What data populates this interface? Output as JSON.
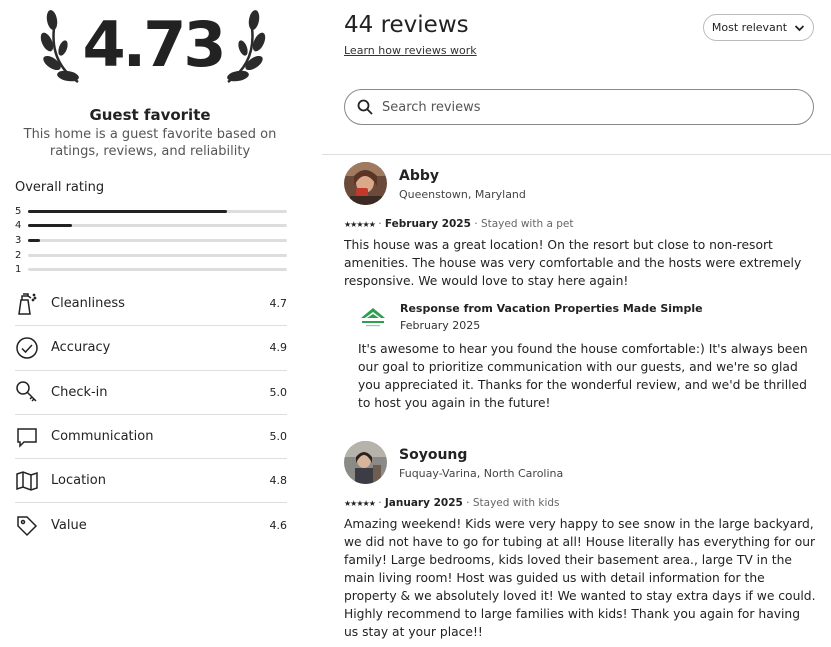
{
  "summary": {
    "overall_score": "4.73",
    "badge_title": "Guest favorite",
    "badge_description": "This home is a guest favorite based on ratings, reviews, and reliability"
  },
  "overall_rating": {
    "title": "Overall rating",
    "distribution": [
      {
        "stars": "5",
        "fraction": 0.77
      },
      {
        "stars": "4",
        "fraction": 0.17
      },
      {
        "stars": "3",
        "fraction": 0.045
      },
      {
        "stars": "2",
        "fraction": 0
      },
      {
        "stars": "1",
        "fraction": 0
      }
    ]
  },
  "categories": [
    {
      "label": "Cleanliness",
      "score": "4.7",
      "icon": "spray-bottle-icon"
    },
    {
      "label": "Accuracy",
      "score": "4.9",
      "icon": "check-circle-icon"
    },
    {
      "label": "Check-in",
      "score": "5.0",
      "icon": "key-icon"
    },
    {
      "label": "Communication",
      "score": "5.0",
      "icon": "chat-bubble-icon"
    },
    {
      "label": "Location",
      "score": "4.8",
      "icon": "map-icon"
    },
    {
      "label": "Value",
      "score": "4.6",
      "icon": "tag-icon"
    }
  ],
  "reviews_header": {
    "count_label": "44 reviews",
    "learn_link": "Learn how reviews work",
    "sort_label": "Most relevant",
    "search_placeholder": "Search reviews"
  },
  "reviews": [
    {
      "name": "Abby",
      "location": "Queenstown, Maryland",
      "stars": "★★★★★",
      "date": "February 2025",
      "stay_note": "Stayed with a pet",
      "text": "This house was a great location! On the resort but close to non-resort amenities. The house was very comfortable and the hosts were extremely responsive. We would love to stay here again!",
      "response": {
        "title": "Response from Vacation Properties Made Simple",
        "date": "February 2025",
        "text": "It's awesome to hear you found the house comfortable:) It's always been our goal to prioritize communication with our guests, and we're so glad you appreciated it. Thanks for the wonderful review, and we'd be thrilled to host you again in the future!"
      }
    },
    {
      "name": "Soyoung",
      "location": "Fuquay-Varina, North Carolina",
      "stars": "★★★★★",
      "date": "January 2025",
      "stay_note": "Stayed with kids",
      "text": "Amazing weekend! Kids were very happy to see snow in the large backyard, we did not have to go for tubing at all! House literally has everything for our family! Large bedrooms, kids loved their basement area., large TV in the main living room! Host was guided us with detail information for the property & we absolutely loved it!  We wanted to stay extra days if we could.  Highly recommend to large families with kids! Thank you again for having us stay at your place!!"
    }
  ],
  "colors": {
    "text_primary": "#222222",
    "text_muted": "#666666",
    "divider": "#dddddd",
    "bar_fill": "#222222",
    "bar_track": "#dddddd",
    "host_logo_green": "#2e9e4f"
  }
}
